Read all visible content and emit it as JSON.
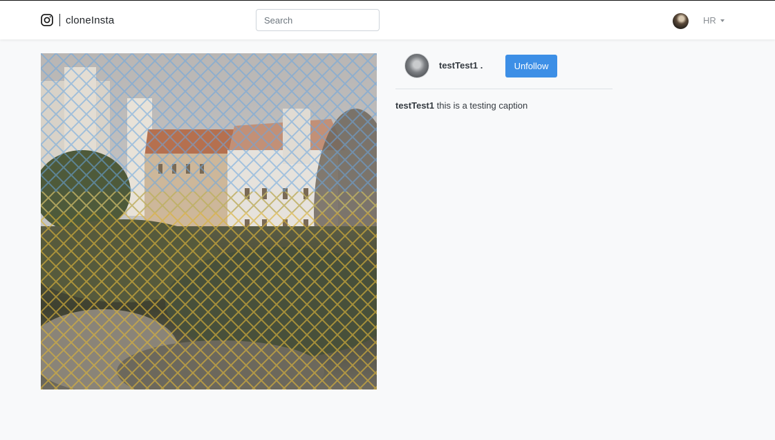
{
  "navbar": {
    "brand_name": "cloneInsta",
    "brand_icon": "instagram-icon",
    "search_placeholder": "Search",
    "user_label": "HR",
    "user_menu_icon": "caret-down-icon"
  },
  "post": {
    "image_subject": "castle-photo",
    "author": {
      "username": "testTest1 .",
      "follow_button_label": "Unfollow"
    },
    "caption": {
      "username": "testTest1",
      "text": " this is a testing caption"
    }
  },
  "colors": {
    "page_background": "#f8f9fa",
    "navbar_background": "#ffffff",
    "primary_button": "#3d8fe6"
  }
}
